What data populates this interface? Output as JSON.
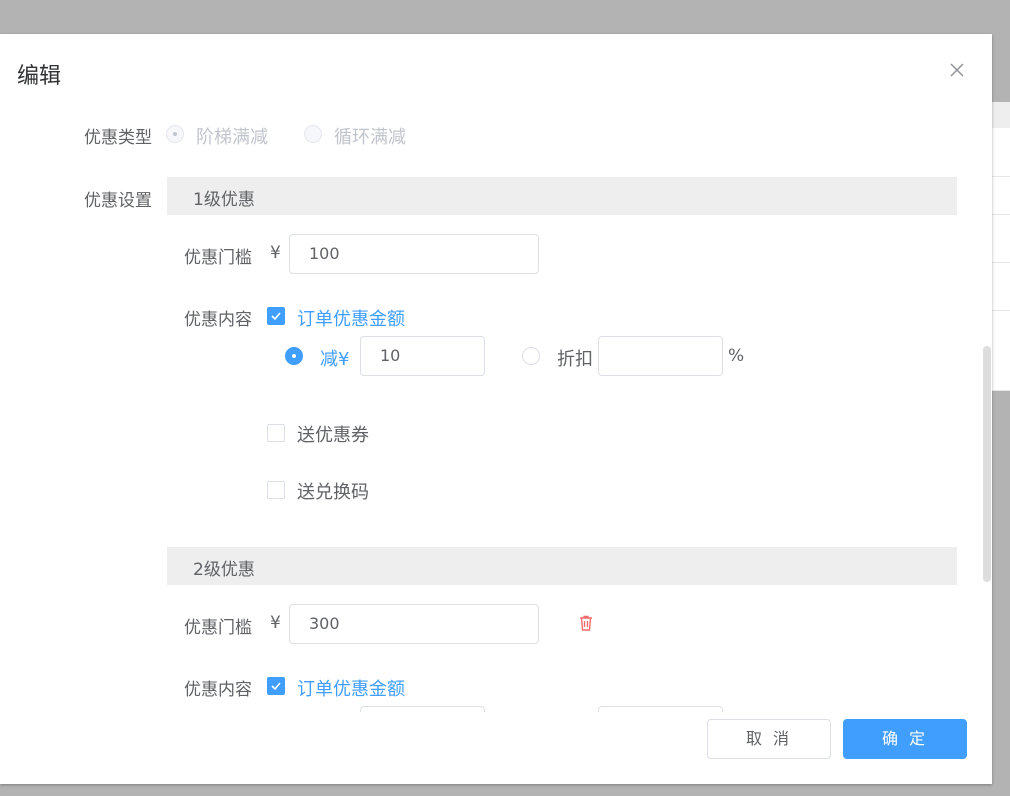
{
  "dialog": {
    "title": "编辑",
    "cancel_label": "取 消",
    "ok_label": "确 定"
  },
  "form": {
    "type_label": "优惠类型",
    "type_options": [
      "阶梯满减",
      "循环满减"
    ],
    "settings_label": "优惠设置",
    "tiers": [
      {
        "title": "1级优惠",
        "threshold_label": "优惠门槛",
        "currency": "¥",
        "threshold_value": "100",
        "content_label": "优惠内容",
        "order_discount_label": "订单优惠金额",
        "reduce_label": "减¥",
        "reduce_value": "10",
        "discount_label": "折扣",
        "discount_value": "",
        "percent": "%",
        "coupon_label": "送优惠券",
        "code_label": "送兑换码"
      },
      {
        "title": "2级优惠",
        "threshold_label": "优惠门槛",
        "currency": "¥",
        "threshold_value": "300",
        "content_label": "优惠内容",
        "order_discount_label": "订单优惠金额"
      }
    ]
  },
  "icons": {
    "close": "close-icon",
    "check": "check-icon",
    "delete": "trash-icon"
  },
  "colors": {
    "accent": "#409eff",
    "danger": "#f56c6c"
  }
}
